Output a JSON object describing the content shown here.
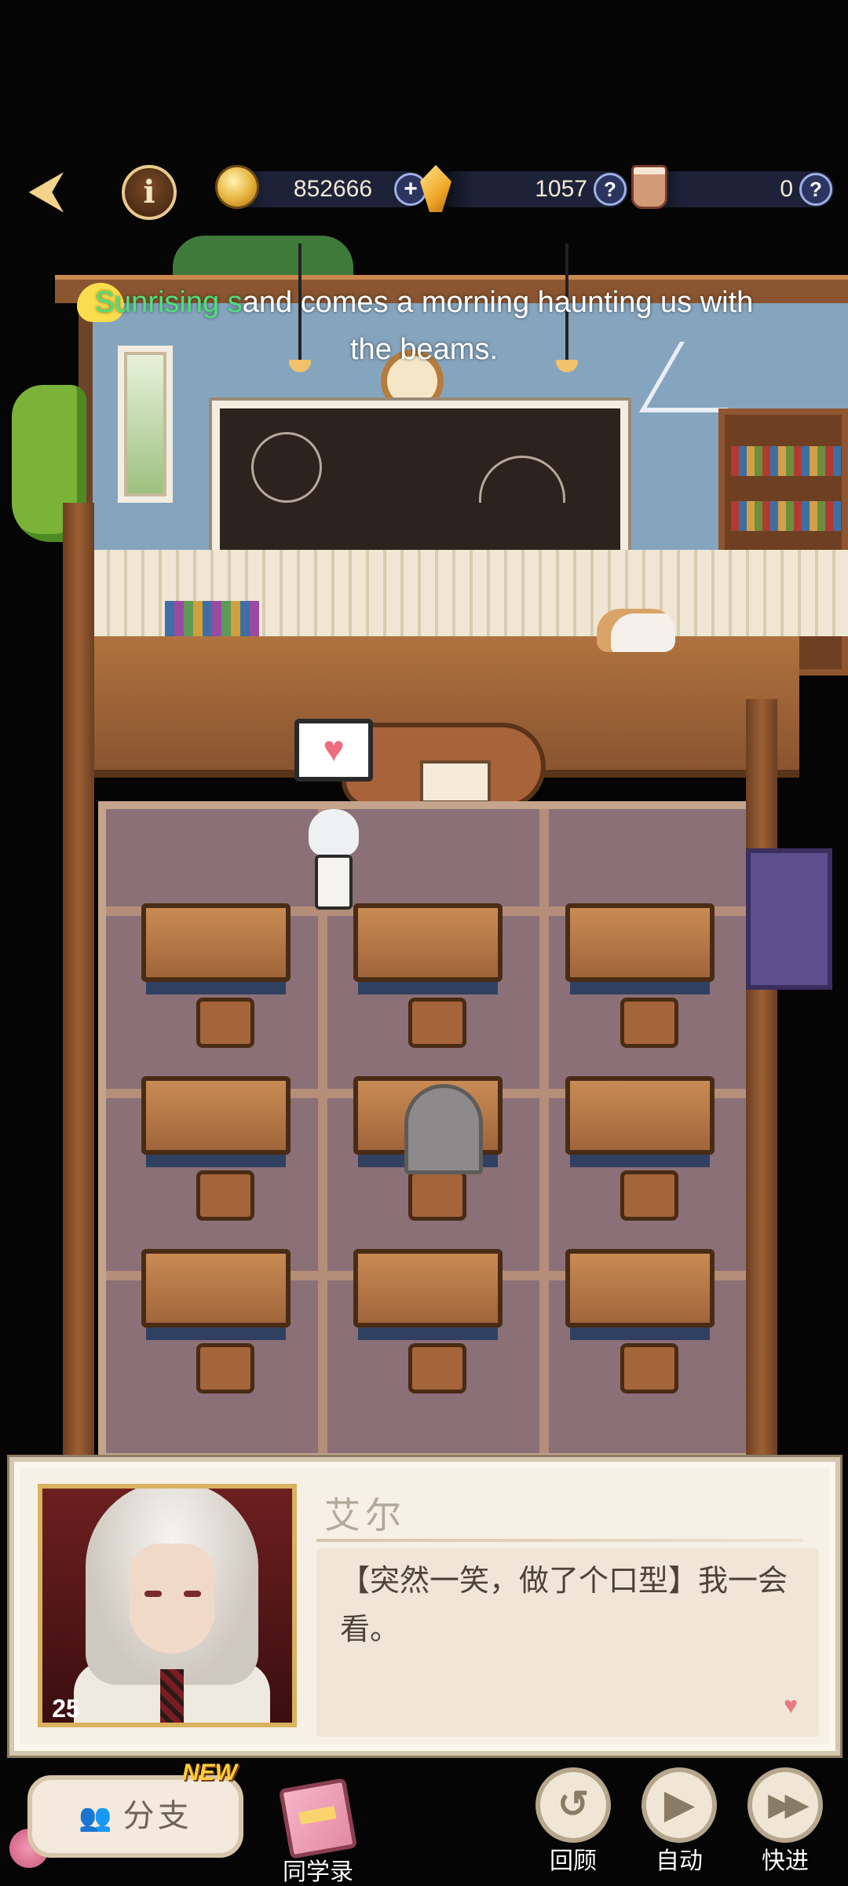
{
  "hud": {
    "back_icon": "back-arrow-icon",
    "info_label": "i",
    "currencies": [
      {
        "name": "coin",
        "icon": "coin-icon",
        "value": "852666",
        "action": "+"
      },
      {
        "name": "gem",
        "icon": "gem-icon",
        "value": "1057",
        "action": "?"
      },
      {
        "name": "tea",
        "icon": "milk-tea-icon",
        "value": "0",
        "action": "?"
      }
    ]
  },
  "subtitle": {
    "sung": "Sunrising s",
    "rest": "and comes a morning haunting us with the beams."
  },
  "scene": {
    "bubble": "♥"
  },
  "dialog": {
    "speaker": "艾尔",
    "text": "【突然一笑，做了个口型】我一会看。",
    "affinity": "25",
    "heart": "♥"
  },
  "bottom": {
    "branch_label": "分支",
    "branch_icon": "people-icon",
    "new_badge": "NEW",
    "classmates_label": "同学录",
    "review_label": "回顾",
    "auto_label": "自动",
    "skip_label": "快进",
    "review_glyph": "↺",
    "auto_glyph": "▶",
    "skip_glyph": "▶▶"
  },
  "colors": {
    "accent_gold": "#f3d28c",
    "subtitle_sung": "#4fe07a",
    "dialog_bg": "#f6f0e6"
  }
}
